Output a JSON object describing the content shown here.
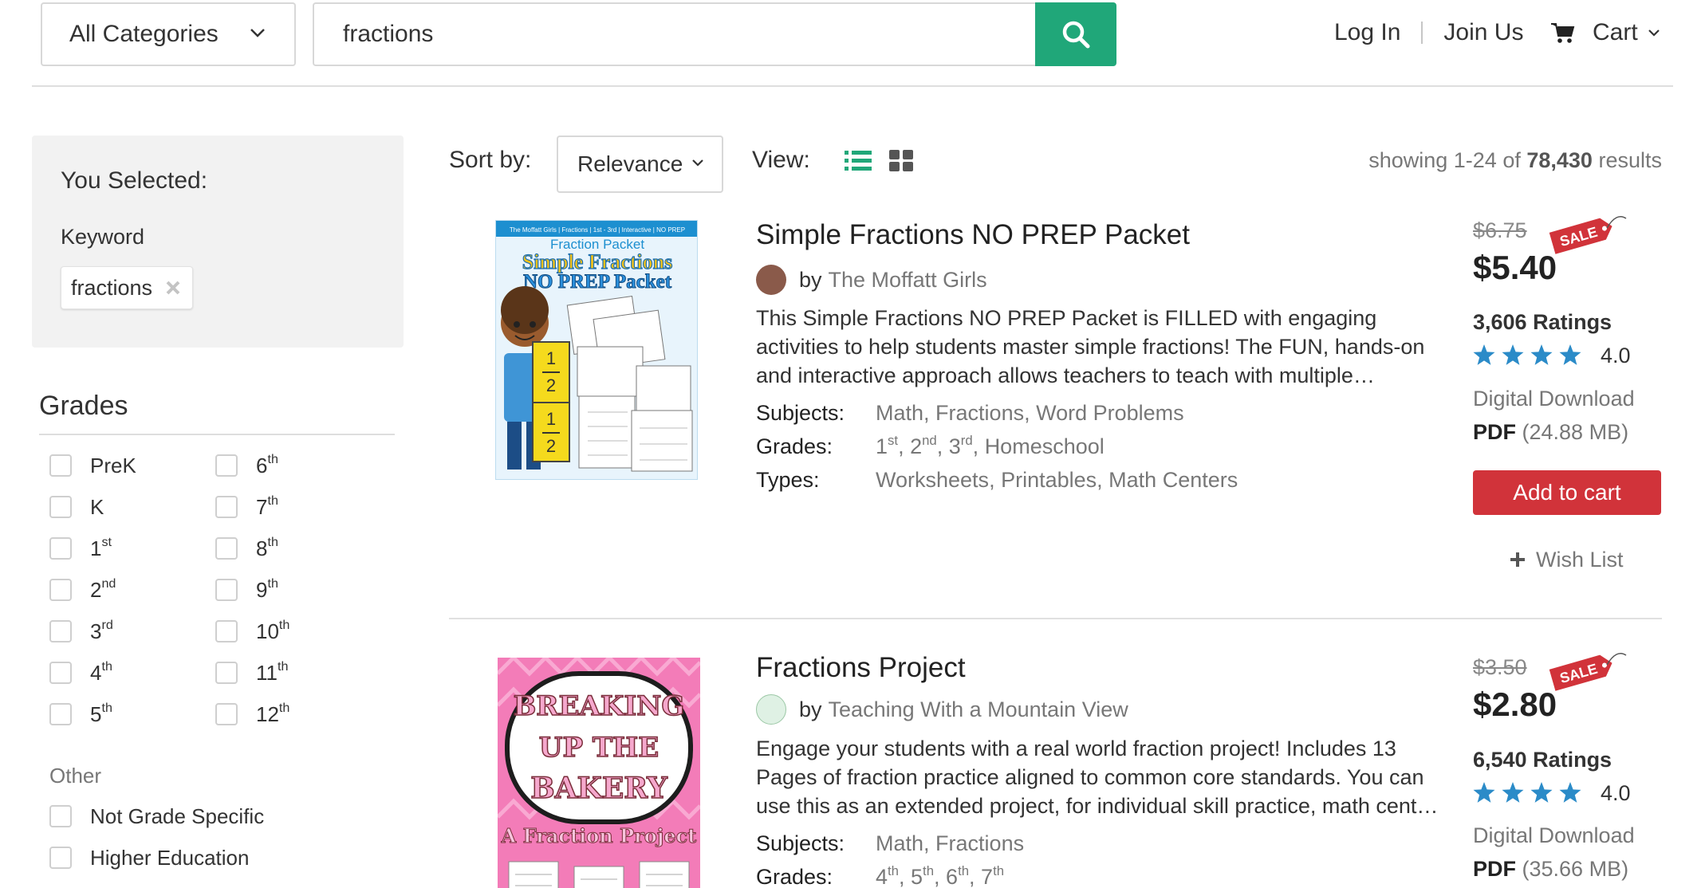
{
  "header": {
    "category_label": "All Categories",
    "search_value": "fractions",
    "login": "Log In",
    "join": "Join Us",
    "cart": "Cart"
  },
  "filters": {
    "selected_title": "You Selected:",
    "keyword_label": "Keyword",
    "keyword_chip": "fractions",
    "grades_title": "Grades",
    "grades_left": [
      {
        "base": "PreK",
        "sup": ""
      },
      {
        "base": "K",
        "sup": ""
      },
      {
        "base": "1",
        "sup": "st"
      },
      {
        "base": "2",
        "sup": "nd"
      },
      {
        "base": "3",
        "sup": "rd"
      },
      {
        "base": "4",
        "sup": "th"
      },
      {
        "base": "5",
        "sup": "th"
      }
    ],
    "grades_right": [
      {
        "base": "6",
        "sup": "th"
      },
      {
        "base": "7",
        "sup": "th"
      },
      {
        "base": "8",
        "sup": "th"
      },
      {
        "base": "9",
        "sup": "th"
      },
      {
        "base": "10",
        "sup": "th"
      },
      {
        "base": "11",
        "sup": "th"
      },
      {
        "base": "12",
        "sup": "th"
      }
    ],
    "other_label": "Other",
    "other_items": [
      "Not Grade Specific",
      "Higher Education"
    ]
  },
  "toolbar": {
    "sort_label": "Sort by:",
    "sort_value": "Relevance",
    "view_label": "View:",
    "results_prefix": "showing 1-24 of",
    "results_count": "78,430",
    "results_suffix": "results"
  },
  "products": [
    {
      "title": "Simple Fractions NO PREP Packet",
      "by": "by",
      "author": "The Moffatt Girls",
      "description": "This Simple Fractions NO PREP Packet is FILLED with engaging activities to help students master simple fractions! The FUN, hands-on and interactive approach allows teachers to teach with multiple…",
      "subjects_label": "Subjects:",
      "subjects": [
        "Math",
        "Fractions",
        "Word Problems"
      ],
      "grades_label": "Grades:",
      "grades": [
        {
          "base": "1",
          "sup": "st"
        },
        {
          "base": "2",
          "sup": "nd"
        },
        {
          "base": "3",
          "sup": "rd"
        },
        {
          "base": "Homeschool",
          "sup": ""
        }
      ],
      "types_label": "Types:",
      "types": [
        "Worksheets",
        "Printables",
        "Math Centers"
      ],
      "old_price": "$6.75",
      "sale_badge": "SALE",
      "price": "$5.40",
      "ratings": "3,606 Ratings",
      "rating_value": "4.0",
      "format": "Digital Download",
      "file_type": "PDF",
      "file_size": "(24.88 MB)",
      "add_to_cart": "Add to cart",
      "wish_list": "Wish List",
      "cover": {
        "top_strip": "The Moffatt Girls | Fractions | 1st - 3rd | Interactive | NO PREP",
        "series": "Fraction Packet",
        "title_line1": "Simple Fractions",
        "title_line2": "NO PREP Packet",
        "fraction_num": "1",
        "fraction_den": "2"
      }
    },
    {
      "title": "Fractions Project",
      "by": "by",
      "author": "Teaching With a Mountain View",
      "description": "Engage your students with a real world fraction project! Includes 13 Pages of fraction practice aligned to common core standards. You can use this as an extended project, for individual skill practice, math cent…",
      "subjects_label": "Subjects:",
      "subjects": [
        "Math",
        "Fractions"
      ],
      "grades_label": "Grades:",
      "grades": [
        {
          "base": "4",
          "sup": "th"
        },
        {
          "base": "5",
          "sup": "th"
        },
        {
          "base": "6",
          "sup": "th"
        },
        {
          "base": "7",
          "sup": "th"
        }
      ],
      "old_price": "$3.50",
      "sale_badge": "SALE",
      "price": "$2.80",
      "ratings": "6,540 Ratings",
      "rating_value": "4.0",
      "format": "Digital Download",
      "file_type": "PDF",
      "file_size": "(35.66 MB)",
      "cover": {
        "line1": "BREAKING",
        "line2": "UP THE",
        "line3": "BAKERY",
        "subtitle": "A Fraction Project"
      }
    }
  ],
  "colors": {
    "search_button": "#20a779",
    "view_active": "#20a779",
    "add_to_cart": "#d1333a",
    "sale_badge": "#d1333a",
    "stars": "#2b8bc8"
  },
  "icons": [
    "chevron-down-icon",
    "search-icon",
    "cart-icon",
    "close-icon",
    "list-view-icon",
    "grid-view-icon",
    "star-icon",
    "plus-icon",
    "sale-tag-icon"
  ]
}
